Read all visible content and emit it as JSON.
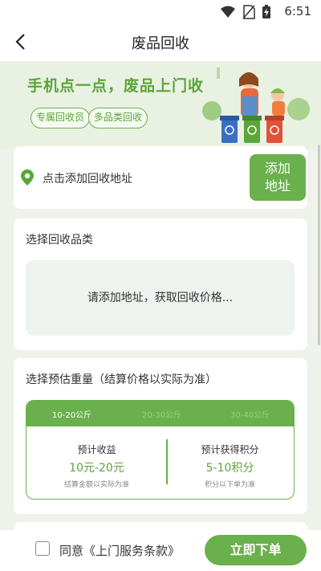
{
  "status_bar": {
    "time": "6:51",
    "icons": [
      "wifi-icon",
      "no-sim-icon",
      "battery-charging-icon"
    ]
  },
  "header": {
    "title": "废品回收",
    "back_icon": "chevron-left-icon"
  },
  "banner": {
    "slogan": "手机点一点，废品上门收",
    "tags": [
      "专属回收员",
      "多品类回收"
    ]
  },
  "address": {
    "prompt": "点击添加回收地址",
    "button_label": "添加\n地址",
    "icon": "location-pin-icon"
  },
  "category": {
    "title": "选择回收品类",
    "placeholder": "请添加地址，获取回收价格..."
  },
  "weight": {
    "title": "选择预估重量（结算价格以实际为准）",
    "tabs": [
      "10-20公斤",
      "20-30公斤",
      "30-40公斤"
    ],
    "selected_tab": 0,
    "income": {
      "label": "预计收益",
      "value": "10元-20元",
      "note": "结算金额以实际为准"
    },
    "points": {
      "label": "预计获得积分",
      "value": "5-10积分",
      "note": "积分以下单为准"
    }
  },
  "footer": {
    "agree_text": "同意《上门服务条款》",
    "order_button": "立即下单",
    "agreed": false
  },
  "colors": {
    "accent": "#6ab04c",
    "accent_text": "#5aa637",
    "background": "#eef2ea"
  }
}
